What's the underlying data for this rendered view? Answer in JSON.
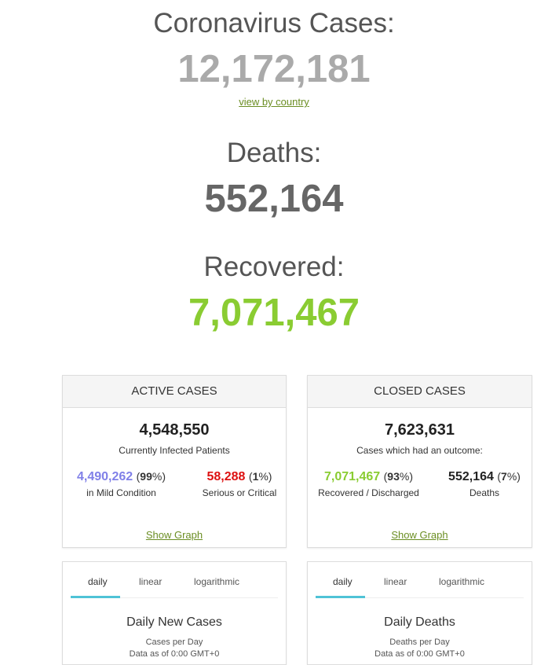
{
  "hero": {
    "cases_title": "Coronavirus Cases:",
    "cases_value": "12,172,181",
    "view_link": "view by country",
    "deaths_title": "Deaths:",
    "deaths_value": "552,164",
    "recovered_title": "Recovered:",
    "recovered_value": "7,071,467"
  },
  "active": {
    "header": "ACTIVE CASES",
    "total": "4,548,550",
    "subtitle": "Currently Infected Patients",
    "mild_value": "4,490,262",
    "mild_pct": "99",
    "mild_label": "in Mild Condition",
    "serious_value": "58,288",
    "serious_pct": "1",
    "serious_label": "Serious or Critical",
    "show_graph": "Show Graph"
  },
  "closed": {
    "header": "CLOSED CASES",
    "total": "7,623,631",
    "subtitle": "Cases which had an outcome:",
    "recovered_value": "7,071,467",
    "recovered_pct": "93",
    "recovered_label": "Recovered / Discharged",
    "deaths_value": "552,164",
    "deaths_pct": "7",
    "deaths_label": "Deaths",
    "show_graph": "Show Graph"
  },
  "chart_left": {
    "tabs": [
      "daily",
      "linear",
      "logarithmic"
    ],
    "active_tab": "daily",
    "title": "Daily New Cases",
    "subtitle": "Cases per Day",
    "note": "Data as of 0:00 GMT+0"
  },
  "chart_right": {
    "tabs": [
      "daily",
      "linear",
      "logarithmic"
    ],
    "active_tab": "daily",
    "title": "Daily Deaths",
    "subtitle": "Deaths per Day",
    "note": "Data as of 0:00 GMT+0"
  },
  "colors": {
    "mild": "#8080e8",
    "serious": "#dd1010",
    "recovered": "#8acc32",
    "link": "#6b8e23",
    "tab_underline": "#4fc3d6"
  }
}
